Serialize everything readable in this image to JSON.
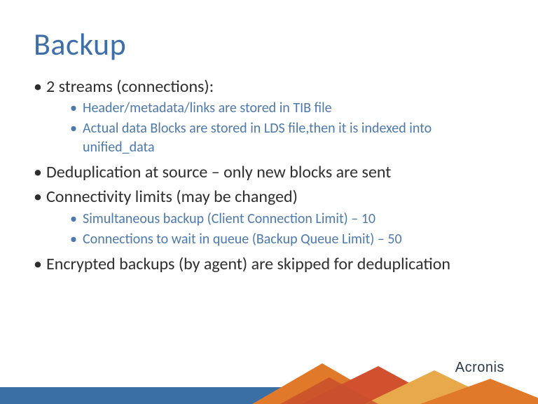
{
  "title": "Backup",
  "bullets": [
    {
      "text": "2 streams (connections):",
      "sub": [
        "Header/metadata/links are stored in TIB file",
        "Actual data Blocks are stored in LDS file,then it is indexed into unified_data"
      ]
    },
    {
      "text": "Deduplication at source – only new blocks are sent"
    },
    {
      "text": "Connectivity limits (may be changed)",
      "sub": [
        "Simultaneous backup (Client Connection Limit) – 10",
        "Connections to wait in queue (Backup Queue Limit) – 50"
      ]
    },
    {
      "text": "Encrypted backups (by agent) are skipped for deduplication"
    }
  ],
  "brand": "Acronis",
  "colors": {
    "title": "#3f6fa8",
    "body": "#2e2e2e",
    "sub": "#4d79ab",
    "footer_blue": "#3a6fa6",
    "footer_orange": "#e07a2a",
    "footer_red": "#c94f2c",
    "footer_gold": "#e8a94a"
  }
}
